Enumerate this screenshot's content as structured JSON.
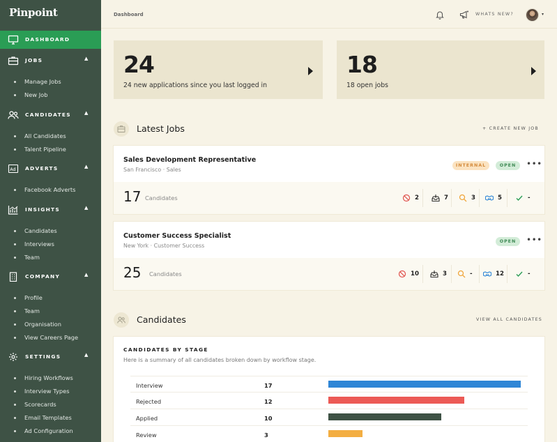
{
  "app": {
    "logo": "Pinpoint"
  },
  "sidebar": {
    "sections": [
      {
        "label": "DASHBOARD",
        "icon": "monitor-icon",
        "active": true,
        "items": []
      },
      {
        "label": "JOBS",
        "icon": "briefcase-icon",
        "items": [
          "Manage Jobs",
          "New Job"
        ]
      },
      {
        "label": "CANDIDATES",
        "icon": "users-icon",
        "items": [
          "All Candidates",
          "Talent Pipeline"
        ]
      },
      {
        "label": "ADVERTS",
        "icon": "ad-icon",
        "items": [
          "Facebook Adverts"
        ]
      },
      {
        "label": "INSIGHTS",
        "icon": "chart-icon",
        "items": [
          "Candidates",
          "Interviews",
          "Team"
        ]
      },
      {
        "label": "COMPANY",
        "icon": "building-icon",
        "items": [
          "Profile",
          "Team",
          "Organisation",
          "View Careers Page"
        ]
      },
      {
        "label": "SETTINGS",
        "icon": "gear-icon",
        "items": [
          "Hiring Workflows",
          "Interview Types",
          "Scorecards",
          "Email Templates",
          "Ad Configuration"
        ]
      }
    ],
    "chevron": "▲"
  },
  "header": {
    "breadcrumb": "Dashboard",
    "whats_new": "WHATS NEW?",
    "avatar_chevron": "▾"
  },
  "stats": [
    {
      "value": "24",
      "caption": "24 new applications since you last logged in"
    },
    {
      "value": "18",
      "caption": "18 open jobs"
    }
  ],
  "latest_jobs": {
    "title": "Latest Jobs",
    "create_link": "+  CREATE NEW JOB",
    "menu": "•••",
    "jobs": [
      {
        "title": "Sales Development Representative",
        "subtitle": "San Francisco · Sales",
        "badges": [
          "INTERNAL",
          "OPEN"
        ],
        "count": "17",
        "count_label": "Candidates",
        "metrics": {
          "rejected": "2",
          "applied": "7",
          "review": "3",
          "interview": "5",
          "hired": "-"
        }
      },
      {
        "title": "Customer Success Specialist",
        "subtitle": "New York · Customer Success",
        "badges": [
          "OPEN"
        ],
        "count": "25",
        "count_label": "Candidates",
        "metrics": {
          "rejected": "10",
          "applied": "3",
          "review": "-",
          "interview": "12",
          "hired": "-"
        }
      }
    ]
  },
  "candidates": {
    "title": "Candidates",
    "view_all": "VIEW ALL CANDIDATES",
    "card_heading": "CANDIDATES BY STAGE",
    "card_desc": "Here is a summary of all candidates broken down by workflow stage.",
    "colors": {
      "Interview": "#2f86d6",
      "Rejected": "#ec5a55",
      "Applied": "#3e5245",
      "Review": "#f3ae42"
    },
    "stages": [
      {
        "name": "Interview",
        "count": 17
      },
      {
        "name": "Rejected",
        "count": 12
      },
      {
        "name": "Applied",
        "count": 10
      },
      {
        "name": "Review",
        "count": 3
      }
    ]
  }
}
